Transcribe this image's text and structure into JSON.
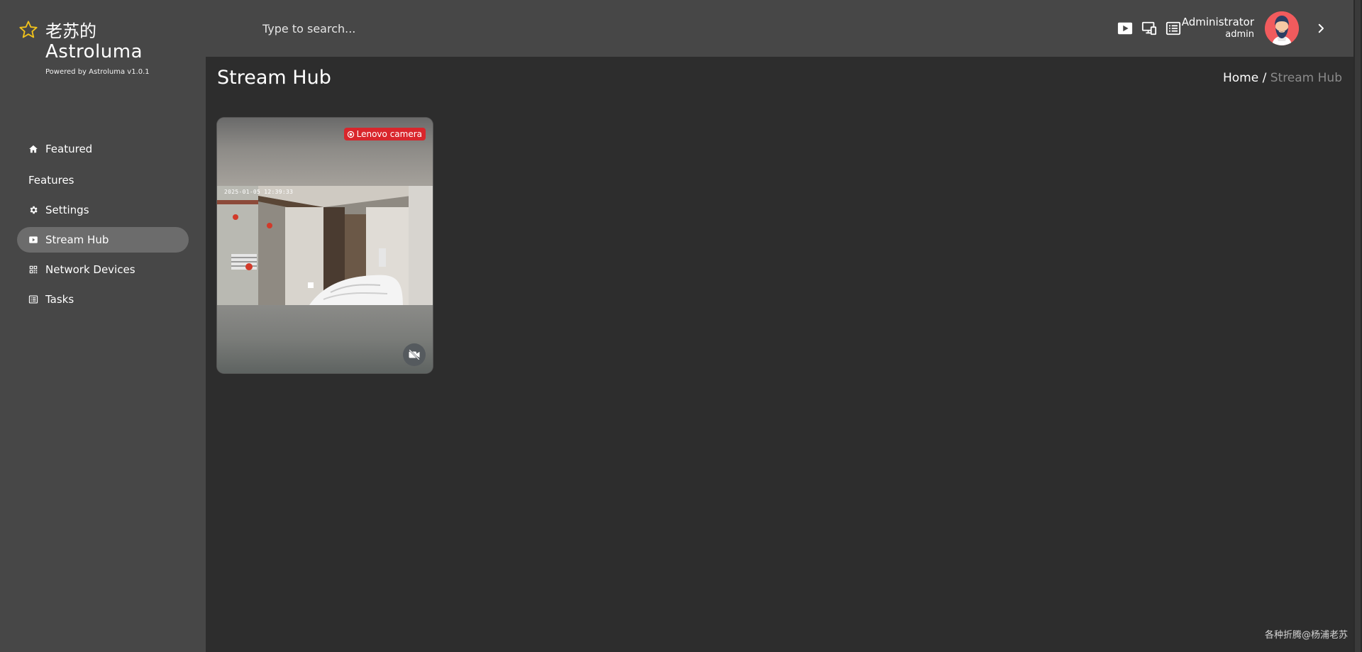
{
  "brand": {
    "name_cn": "老苏的",
    "name_en": "Astroluma",
    "powered_by": "Powered by Astroluma v1.0.1",
    "star_color": "#f1c21b"
  },
  "sidebar": {
    "featured_label": "Featured",
    "section_label": "Features",
    "items": [
      {
        "label": "Settings",
        "icon": "gear-icon"
      },
      {
        "label": "Stream Hub",
        "icon": "play-icon",
        "active": true
      },
      {
        "label": "Network Devices",
        "icon": "qr-icon"
      },
      {
        "label": "Tasks",
        "icon": "list-icon"
      }
    ]
  },
  "search": {
    "placeholder": "Type to search..."
  },
  "header_icons": [
    "play-icon",
    "monitor-icon",
    "list-icon"
  ],
  "user": {
    "name": "Administrator",
    "role": "admin"
  },
  "page": {
    "title": "Stream Hub"
  },
  "breadcrumb": {
    "home": "Home /",
    "current": "Stream Hub"
  },
  "stream": {
    "camera_label": "Lenovo camera",
    "timestamp": "2025-01-05  12:39:33",
    "badge_color": "#d9262c"
  },
  "watermark": "各种折腾@杨浦老苏"
}
